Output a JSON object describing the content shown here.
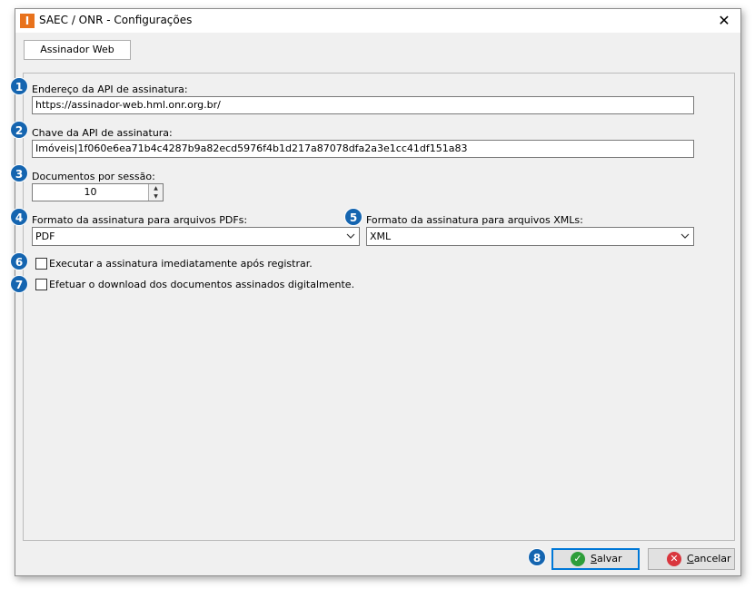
{
  "window": {
    "title": "SAEC / ONR - Configurações",
    "app_icon_glyph": "I",
    "close_glyph": "✕"
  },
  "tabs": [
    {
      "label": "Assinador Web",
      "selected": true
    }
  ],
  "form": {
    "api_address": {
      "label": "Endereço da API de assinatura:",
      "value": "https://assinador-web.hml.onr.org.br/"
    },
    "api_key": {
      "label": "Chave da API de assinatura:",
      "value": "Imóveis|1f060e6ea71b4c4287b9a82ecd5976f4b1d217a87078dfa2a3e1cc41df151a83"
    },
    "docs_per_session": {
      "label": "Documentos por sessão:",
      "value": "10"
    },
    "pdf_format": {
      "label": "Formato da assinatura para arquivos PDFs:",
      "value": "PDF"
    },
    "xml_format": {
      "label": "Formato da assinatura para arquivos XMLs:",
      "value": "XML"
    },
    "execute_immediately": {
      "label": "Executar a assinatura imediatamente após registrar.",
      "checked": false
    },
    "download_signed": {
      "label": "Efetuar o download dos documentos assinados digitalmente.",
      "checked": false
    }
  },
  "buttons": {
    "save": {
      "label_prefix": "",
      "label_underline": "S",
      "label_rest": "alvar",
      "icon": "check-icon"
    },
    "cancel": {
      "label_prefix": "",
      "label_underline": "C",
      "label_rest": "ancelar",
      "icon": "cancel-icon"
    }
  },
  "callouts": [
    "1",
    "2",
    "3",
    "4",
    "5",
    "6",
    "7",
    "8"
  ],
  "colors": {
    "callout": "#1565b0",
    "save_icon": "#2e9e3a",
    "cancel_icon": "#d9363e",
    "app_icon": "#e8721c"
  }
}
